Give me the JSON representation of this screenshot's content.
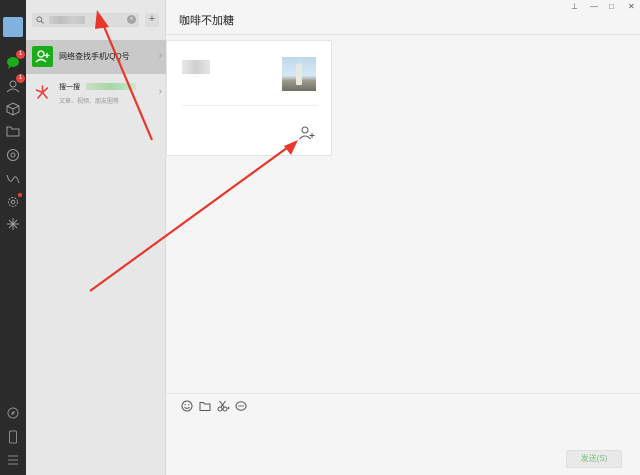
{
  "nav": {
    "chat_badge": "1",
    "contacts_badge": "1"
  },
  "search": {
    "clear_glyph": "×",
    "add_glyph": "+"
  },
  "list": {
    "items": [
      {
        "title": "网络查找手机/QQ号",
        "icon": "add-friend-icon",
        "icon_color": "#1aad19"
      },
      {
        "title": "搜一搜",
        "subtitle": "文章、视频、朋友圈等",
        "icon": "sogou-icon",
        "icon_color": "#e64340"
      }
    ]
  },
  "chat": {
    "title": "咖啡不加糖"
  },
  "window": {
    "pin_glyph": "⊥",
    "minimize_glyph": "—",
    "maximize_glyph": "□",
    "close_glyph": "✕"
  },
  "composer": {
    "send_label": "发送(S)"
  },
  "colors": {
    "arrow": "#e8372b",
    "accent": "#1aad19"
  }
}
